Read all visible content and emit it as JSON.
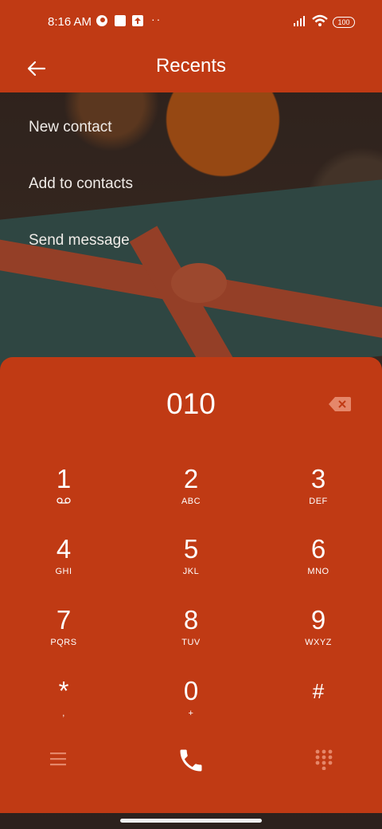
{
  "status_bar": {
    "time": "8:16 AM",
    "battery": "100",
    "icons": [
      "notification-icon",
      "square-icon",
      "upload-icon",
      "more-dots-icon",
      "signal-icon",
      "wifi-icon",
      "battery-icon"
    ]
  },
  "header": {
    "title": "Recents",
    "back_icon": "arrow-left-icon"
  },
  "menu": {
    "items": [
      {
        "label": "New contact"
      },
      {
        "label": "Add to contacts"
      },
      {
        "label": "Send message"
      }
    ]
  },
  "dialer": {
    "number": "010",
    "backspace_icon": "backspace-icon",
    "keys": [
      {
        "digit": "1",
        "letters": ""
      },
      {
        "digit": "2",
        "letters": "ABC"
      },
      {
        "digit": "3",
        "letters": "DEF"
      },
      {
        "digit": "4",
        "letters": "GHI"
      },
      {
        "digit": "5",
        "letters": "JKL"
      },
      {
        "digit": "6",
        "letters": "MNO"
      },
      {
        "digit": "7",
        "letters": "PQRS"
      },
      {
        "digit": "8",
        "letters": "TUV"
      },
      {
        "digit": "9",
        "letters": "WXYZ"
      },
      {
        "digit": "*",
        "letters": ","
      },
      {
        "digit": "0",
        "letters": "+"
      },
      {
        "digit": "#",
        "letters": ""
      }
    ],
    "bottom_icons": [
      "menu-icon",
      "phone-icon",
      "dialpad-icon"
    ]
  },
  "colors": {
    "accent": "#c03a14",
    "text": "#ffffff"
  }
}
